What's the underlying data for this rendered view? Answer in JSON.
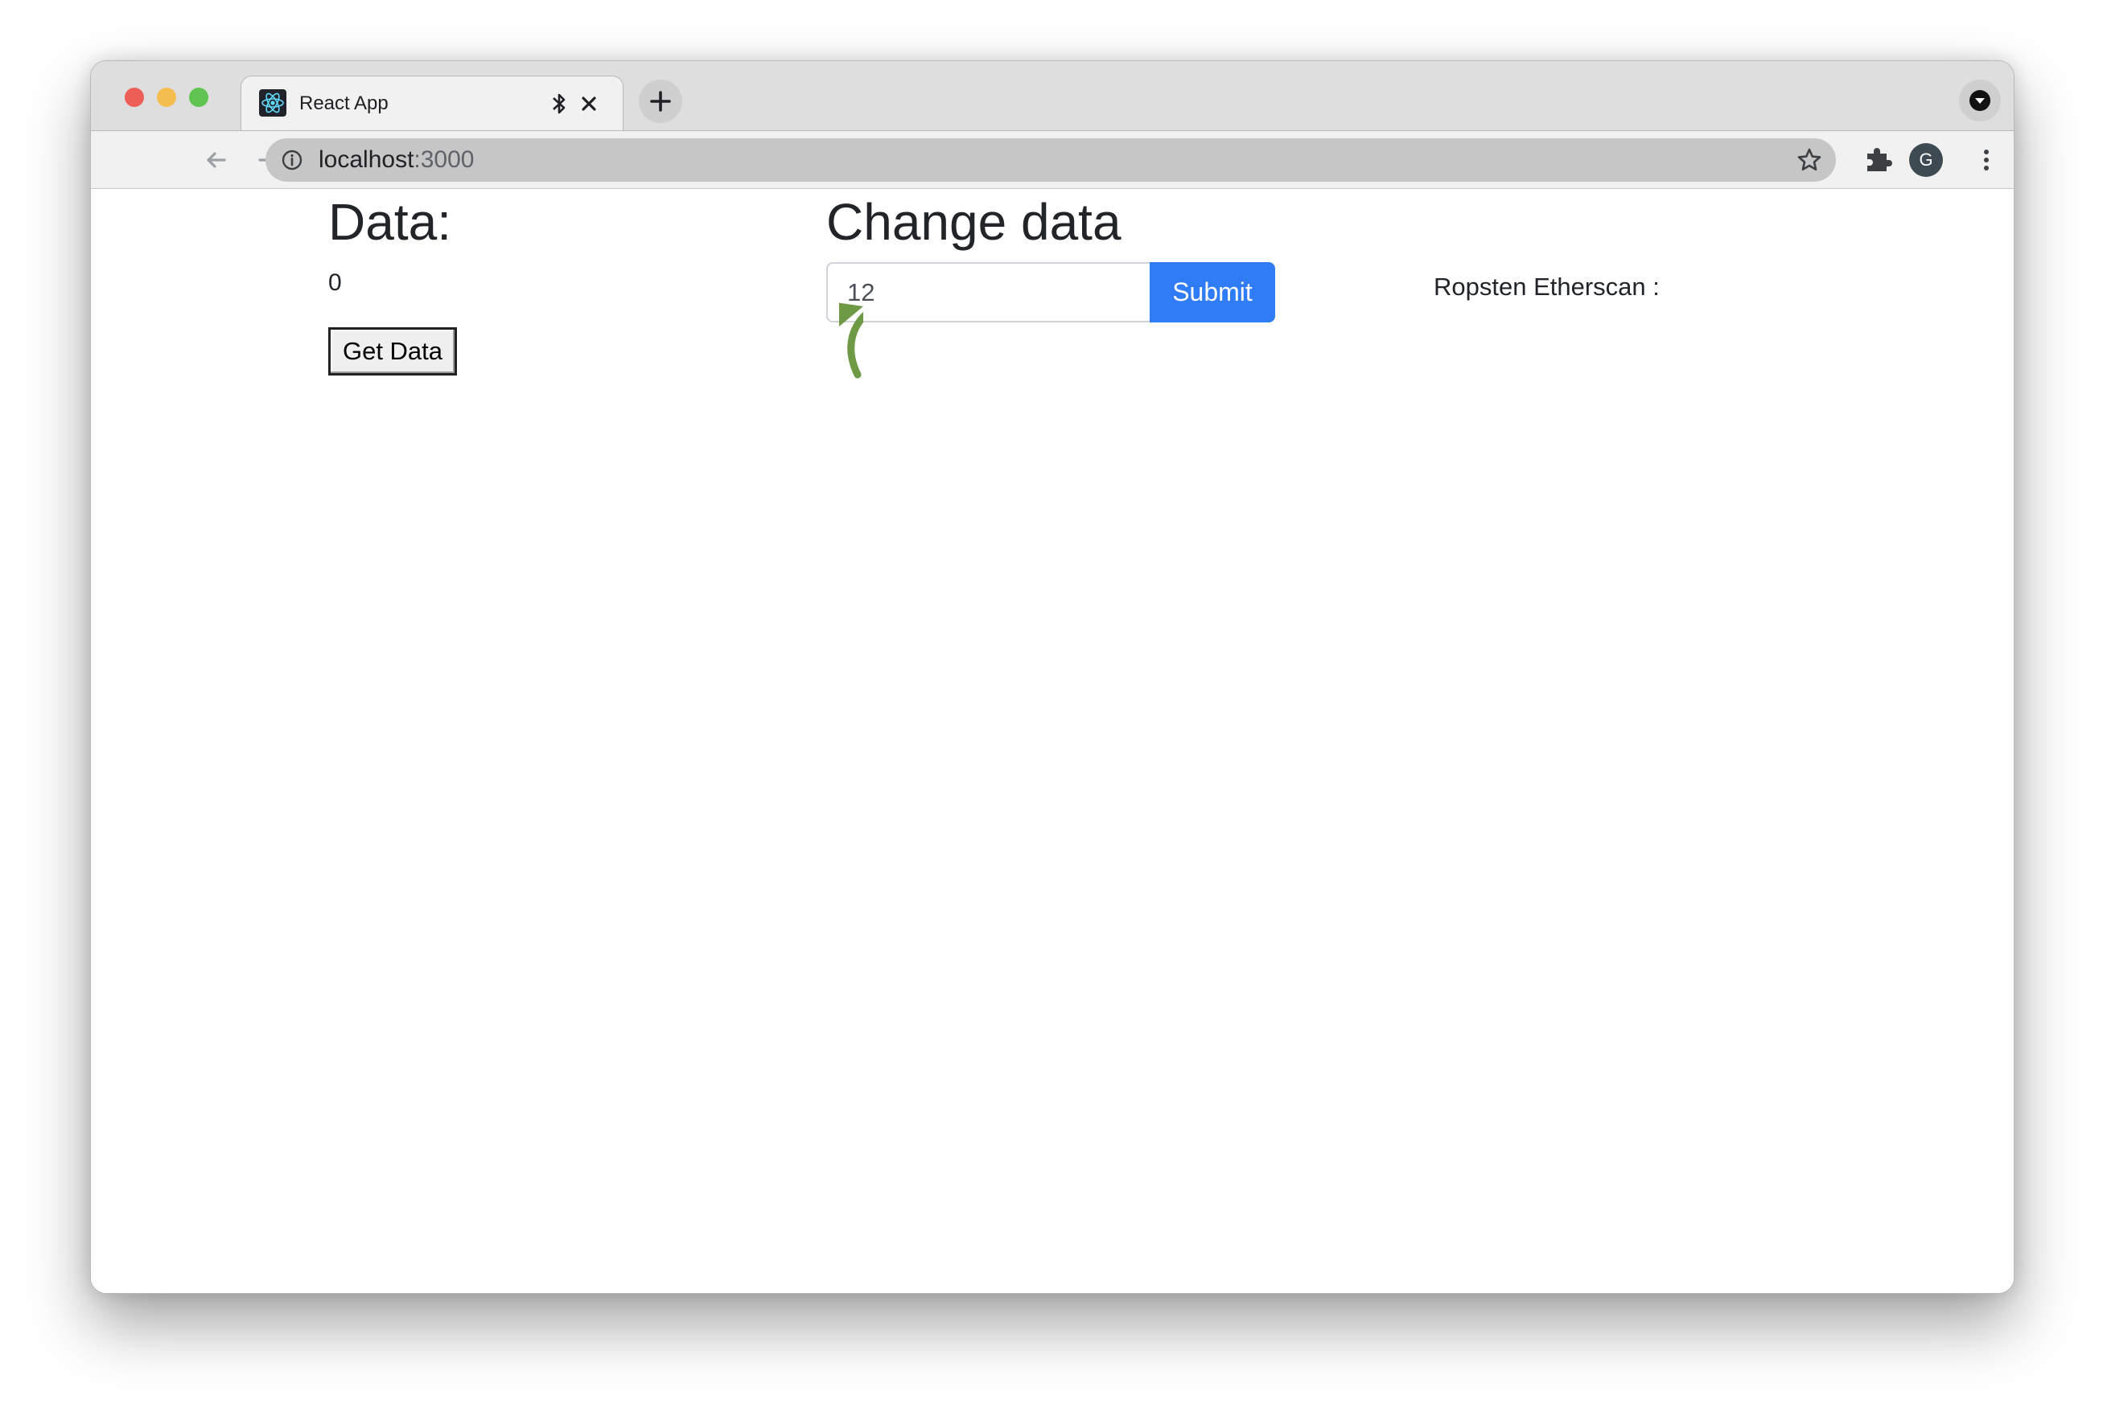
{
  "browser": {
    "tab": {
      "title": "React App"
    },
    "address_bar": {
      "host": "localhost",
      "port": ":3000"
    },
    "profile": {
      "initial": "G"
    }
  },
  "page": {
    "data_section": {
      "title": "Data:",
      "value": "0",
      "get_button_label": "Get Data"
    },
    "change_section": {
      "title": "Change data",
      "input_value": "12",
      "submit_label": "Submit"
    },
    "etherscan_label": "Ropsten Etherscan :"
  },
  "colors": {
    "submit_button": "#2f7cf6",
    "annotation_arrow": "#6f9a45",
    "traffic_red": "#ed5e57",
    "traffic_yellow": "#f4bd4f",
    "traffic_green": "#5fc451"
  },
  "icons": {
    "tab_favicon": "react-logo-icon",
    "tab_bluetooth": "bluetooth-icon",
    "tab_close": "close-icon",
    "new_tab": "plus-icon",
    "nav": [
      "back-arrow-icon",
      "forward-arrow-icon",
      "reload-icon"
    ],
    "site_info": "info-icon",
    "bookmark": "star-icon",
    "extensions": "puzzle-icon",
    "menu": "kebab-menu-icon",
    "annotation": "curved-arrow-icon"
  }
}
